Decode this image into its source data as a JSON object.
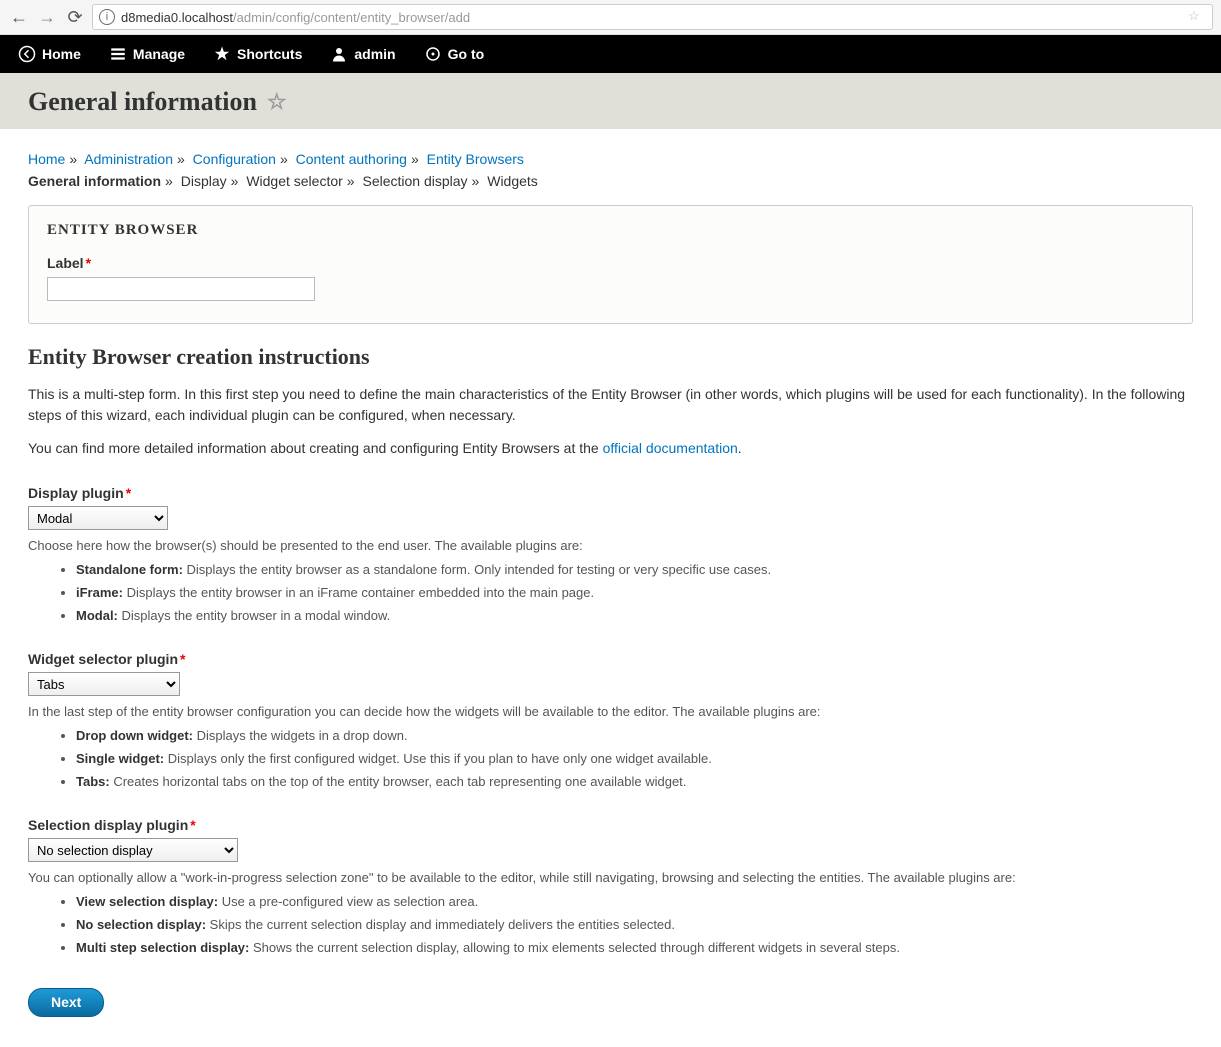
{
  "browser": {
    "url_host": "d8media0.localhost",
    "url_path": "/admin/config/content/entity_browser/add"
  },
  "toolbar": {
    "home": "Home",
    "manage": "Manage",
    "shortcuts": "Shortcuts",
    "user": "admin",
    "goto": "Go to"
  },
  "page_title": "General information",
  "breadcrumb": {
    "home": "Home",
    "admin": "Administration",
    "config": "Configuration",
    "content_auth": "Content authoring",
    "entity_browsers": "Entity Browsers"
  },
  "wizard": {
    "current": "General information",
    "steps": [
      "Display",
      "Widget selector",
      "Selection display",
      "Widgets"
    ]
  },
  "fieldset": {
    "legend": "ENTITY BROWSER",
    "label_label": "Label",
    "label_value": ""
  },
  "instructions": {
    "heading": "Entity Browser creation instructions",
    "p1": "This is a multi-step form. In this first step you need to define the main characteristics of the Entity Browser (in other words, which plugins will be used for each functionality). In the following steps of this wizard, each individual plugin can be configured, when necessary.",
    "p2_pre": "You can find more detailed information about creating and configuring Entity Browsers at the ",
    "p2_link": "official documentation",
    "p2_post": "."
  },
  "display_plugin": {
    "label": "Display plugin",
    "value": "Modal",
    "desc": "Choose here how the browser(s) should be presented to the end user. The available plugins are:",
    "opt1_b": "Standalone form:",
    "opt1_t": " Displays the entity browser as a standalone form. Only intended for testing or very specific use cases.",
    "opt2_b": "iFrame:",
    "opt2_t": " Displays the entity browser in an iFrame container embedded into the main page.",
    "opt3_b": "Modal:",
    "opt3_t": " Displays the entity browser in a modal window."
  },
  "widget_plugin": {
    "label": "Widget selector plugin",
    "value": "Tabs",
    "desc": "In the last step of the entity browser configuration you can decide how the widgets will be available to the editor. The available plugins are:",
    "opt1_b": "Drop down widget:",
    "opt1_t": " Displays the widgets in a drop down.",
    "opt2_b": "Single widget:",
    "opt2_t": " Displays only the first configured widget. Use this if you plan to have only one widget available.",
    "opt3_b": "Tabs:",
    "opt3_t": " Creates horizontal tabs on the top of the entity browser, each tab representing one available widget."
  },
  "selection_plugin": {
    "label": "Selection display plugin",
    "value": "No selection display",
    "desc": "You can optionally allow a \"work-in-progress selection zone\" to be available to the editor, while still navigating, browsing and selecting the entities. The available plugins are:",
    "opt1_b": "View selection display:",
    "opt1_t": " Use a pre-configured view as selection area.",
    "opt2_b": "No selection display:",
    "opt2_t": " Skips the current selection display and immediately delivers the entities selected.",
    "opt3_b": "Multi step selection display:",
    "opt3_t": " Shows the current selection display, allowing to mix elements selected through different widgets in several steps."
  },
  "next_button": "Next"
}
